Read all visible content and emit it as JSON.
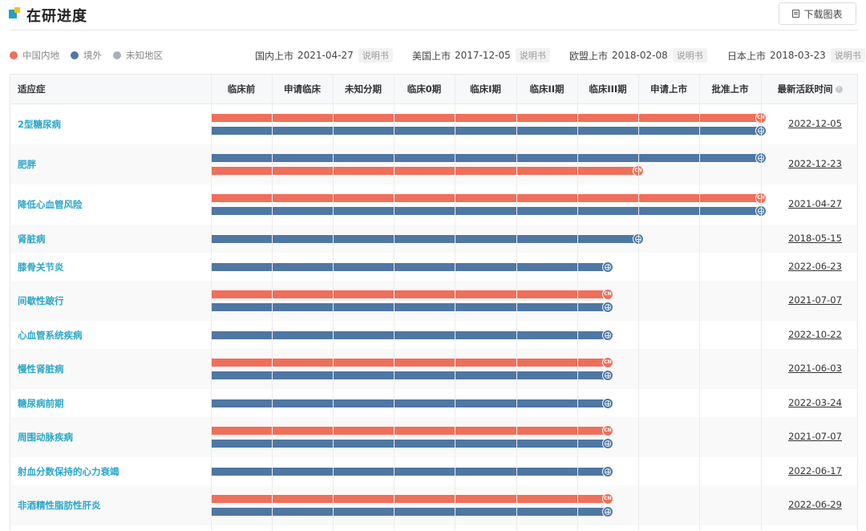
{
  "header": {
    "title": "在研进度",
    "download_label": "下载图表"
  },
  "legend": [
    {
      "label": "中国内地",
      "color": "#ef6f5a"
    },
    {
      "label": "境外",
      "color": "#4e77a3"
    },
    {
      "label": "未知地区",
      "color": "#a9b0bd"
    }
  ],
  "approvals": [
    {
      "label": "国内上市",
      "date": "2021-04-27",
      "manual": "说明书"
    },
    {
      "label": "美国上市",
      "date": "2017-12-05",
      "manual": "说明书"
    },
    {
      "label": "欧盟上市",
      "date": "2018-02-08",
      "manual": "说明书"
    },
    {
      "label": "日本上市",
      "date": "2018-03-23",
      "manual": "说明书"
    }
  ],
  "table": {
    "indication_header": "适应症",
    "phases": [
      "临床前",
      "申请临床",
      "未知分期",
      "临床0期",
      "临床I期",
      "临床II期",
      "临床III期",
      "申请上市",
      "批准上市"
    ],
    "last_active_header": "最新活跃时间",
    "cn_badge": "CN",
    "rows": [
      {
        "indication": "2型糖尿病",
        "last_active": "2022-12-05",
        "bars": [
          {
            "region": "cn",
            "stage": 9
          },
          {
            "region": "ww",
            "stage": 9
          }
        ]
      },
      {
        "indication": "肥胖",
        "last_active": "2022-12-23",
        "bars": [
          {
            "region": "ww",
            "stage": 9
          },
          {
            "region": "cn",
            "stage": 7
          }
        ]
      },
      {
        "indication": "降低心血管风险",
        "last_active": "2021-04-27",
        "bars": [
          {
            "region": "cn",
            "stage": 9
          },
          {
            "region": "ww",
            "stage": 9
          }
        ]
      },
      {
        "indication": "肾脏病",
        "last_active": "2018-05-15",
        "bars": [
          {
            "region": "ww",
            "stage": 7
          }
        ]
      },
      {
        "indication": "膝骨关节炎",
        "last_active": "2022-06-23",
        "bars": [
          {
            "region": "ww",
            "stage": 6.5
          }
        ]
      },
      {
        "indication": "间歇性跛行",
        "last_active": "2021-07-07",
        "bars": [
          {
            "region": "cn",
            "stage": 6.5
          },
          {
            "region": "ww",
            "stage": 6.5
          }
        ]
      },
      {
        "indication": "心血管系统疾病",
        "last_active": "2022-10-22",
        "bars": [
          {
            "region": "ww",
            "stage": 6.5
          }
        ]
      },
      {
        "indication": "慢性肾脏病",
        "last_active": "2021-06-03",
        "bars": [
          {
            "region": "cn",
            "stage": 6.5
          },
          {
            "region": "ww",
            "stage": 6.5
          }
        ]
      },
      {
        "indication": "糖尿病前期",
        "last_active": "2022-03-24",
        "bars": [
          {
            "region": "ww",
            "stage": 6.5
          }
        ]
      },
      {
        "indication": "周围动脉疾病",
        "last_active": "2021-07-07",
        "bars": [
          {
            "region": "cn",
            "stage": 6.5
          },
          {
            "region": "ww",
            "stage": 6.5
          }
        ]
      },
      {
        "indication": "射血分数保持的心力衰竭",
        "last_active": "2022-06-17",
        "bars": [
          {
            "region": "ww",
            "stage": 6.5
          }
        ]
      },
      {
        "indication": "非酒精性脂肪性肝炎",
        "last_active": "2022-06-29",
        "bars": [
          {
            "region": "cn",
            "stage": 6.5
          },
          {
            "region": "ww",
            "stage": 6.5
          }
        ]
      }
    ]
  }
}
